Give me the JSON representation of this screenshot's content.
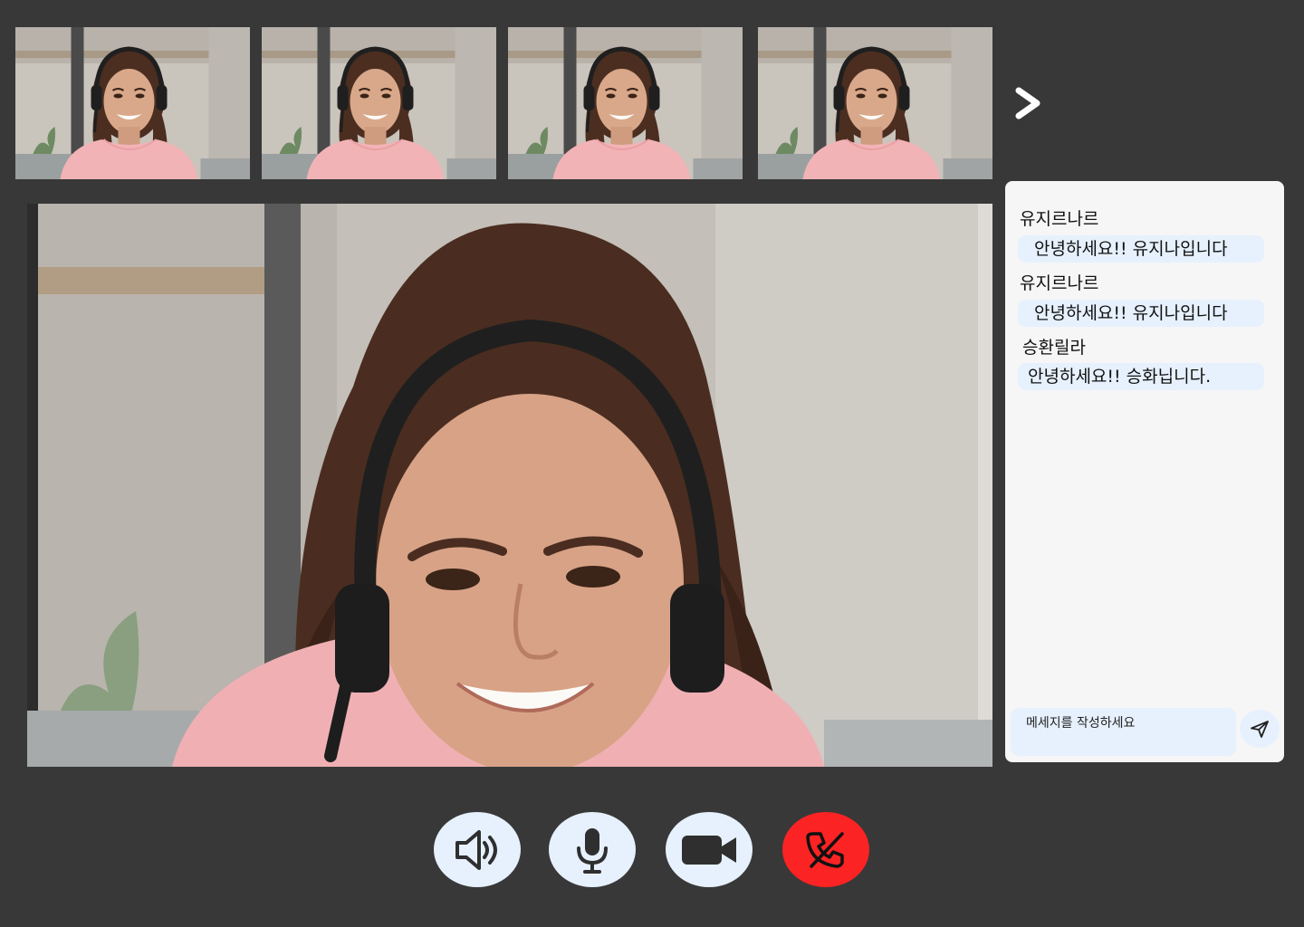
{
  "participants": [
    {
      "icon": "participant-video-thumbnail"
    },
    {
      "icon": "participant-video-thumbnail"
    },
    {
      "icon": "participant-video-thumbnail"
    },
    {
      "icon": "participant-video-thumbnail"
    }
  ],
  "navigation": {
    "next_icon": "chevron-right-icon"
  },
  "main_video": {
    "icon": "active-speaker-video"
  },
  "chat": {
    "messages": [
      {
        "author": "유지르나르",
        "text": "안녕하세요!! 유지나입니다"
      },
      {
        "author": "유지르나르",
        "text": "안녕하세요!! 유지나입니다"
      },
      {
        "author": "승환릴라",
        "text": "안녕하세요!! 승화닙니다."
      }
    ],
    "input_placeholder": "메세지를 작성하세요",
    "input_value": "",
    "send_icon": "send-icon"
  },
  "controls": {
    "speaker_icon": "speaker-icon",
    "mic_icon": "microphone-icon",
    "camera_icon": "video-camera-icon",
    "hangup_icon": "phone-off-icon"
  },
  "colors": {
    "background": "#383838",
    "panel": "#f6f6f7",
    "bubble": "#e6f1fd",
    "control_button": "#e6f1fd",
    "hangup": "#fb2323",
    "icon": "#2f2f2f"
  }
}
